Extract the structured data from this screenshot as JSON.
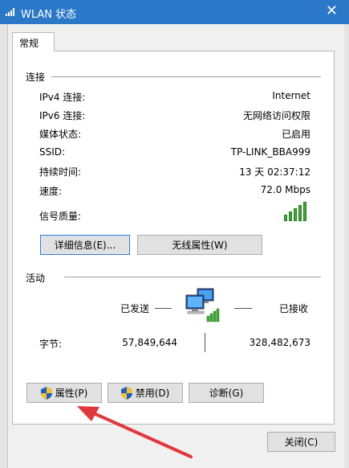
{
  "window": {
    "title": "WLAN 状态"
  },
  "tabs": [
    {
      "label": "常规"
    }
  ],
  "connection": {
    "heading": "连接",
    "rows": [
      {
        "label": "IPv4 连接:",
        "value": "Internet"
      },
      {
        "label": "IPv6 连接:",
        "value": "无网络访问权限"
      },
      {
        "label": "媒体状态:",
        "value": "已启用"
      },
      {
        "label": "SSID:",
        "value": "TP-LINK_BBA999"
      },
      {
        "label": "持续时间:",
        "value": "13 天 02:37:12"
      },
      {
        "label": "速度:",
        "value": "72.0 Mbps"
      }
    ],
    "signal_label": "信号质量:",
    "signal_level": 5,
    "details_button": "详细信息(E)...",
    "wireless_props_button": "无线属性(W)"
  },
  "activity": {
    "heading": "活动",
    "sent_label": "已发送",
    "received_label": "已接收",
    "bytes_label": "字节:",
    "bytes_sent": "57,849,644",
    "bytes_received": "328,482,673"
  },
  "buttons": {
    "properties": "属性(P)",
    "disable": "禁用(D)",
    "diagnose": "诊断(G)",
    "close": "关闭(C)"
  },
  "colors": {
    "titlebar": "#2b78c8",
    "signal": "#3fa535",
    "arrow": "#e2373a"
  }
}
